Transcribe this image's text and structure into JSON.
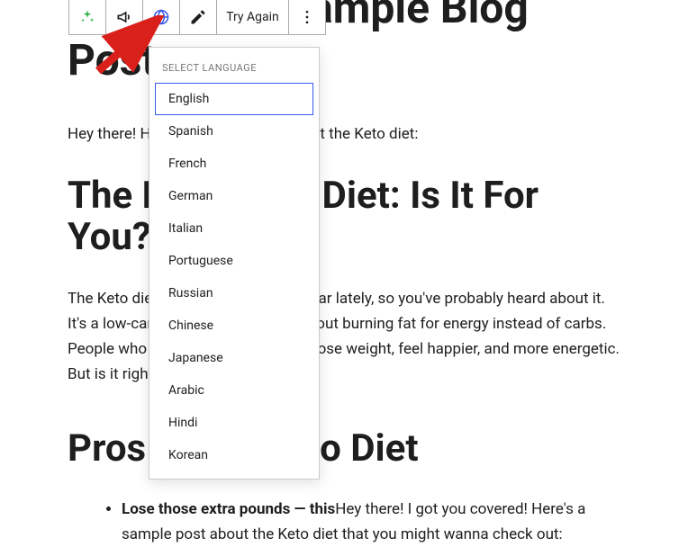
{
  "page": {
    "title": "This Is MY Sample Blog Post",
    "intro": "Hey there! Here's a sample post about the Keto diet:",
    "h2_a": "The Ketogenic Diet: Is It For You?",
    "para_a": "The Keto diet has become very popular lately, so you've probably heard about it. It's a low-carb, high-fat diet. It's all about burning fat for energy instead of carbs. People who have tried it say it helps lose weight, feel happier, and more energetic. But is it right for everyone?",
    "h2_b": "Pros of the Keto Diet",
    "bullet_prefix_bold": "Lose those extra pounds — this",
    "bullet_rest": "Hey there! I got you covered! Here's a sample post about the Keto diet that you might wanna check out:"
  },
  "toolbar": {
    "try_again_label": "Try Again"
  },
  "dropdown": {
    "header": "SELECT LANGUAGE",
    "items": [
      "English",
      "Spanish",
      "French",
      "German",
      "Italian",
      "Portuguese",
      "Russian",
      "Chinese",
      "Japanese",
      "Arabic",
      "Hindi",
      "Korean"
    ],
    "selected_index": 0
  }
}
